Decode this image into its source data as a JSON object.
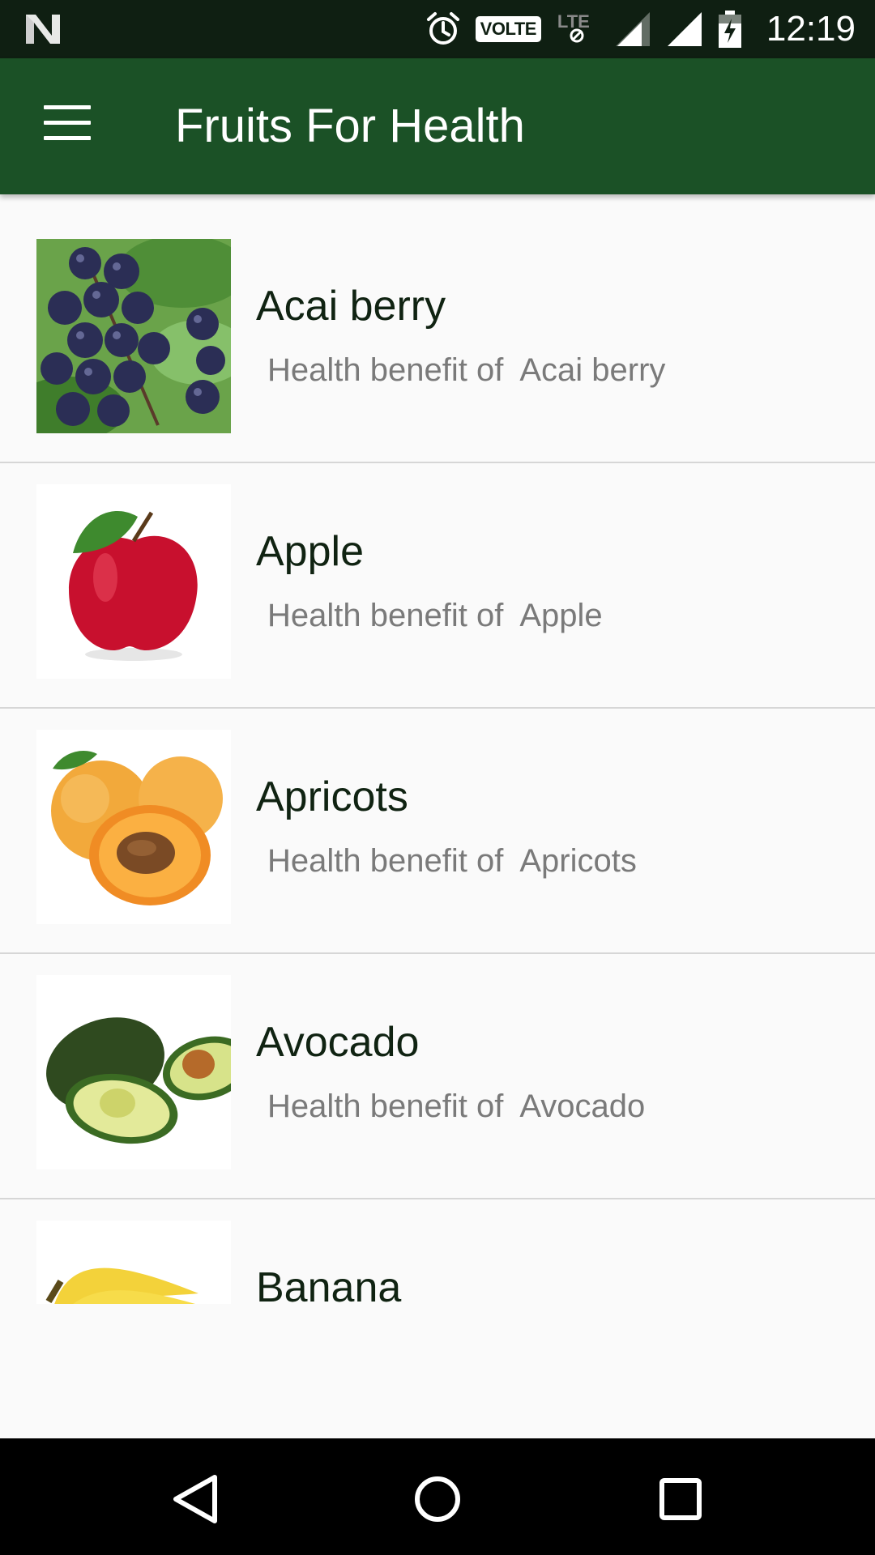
{
  "status_bar": {
    "time": "12:19",
    "volte_label": "VOLTE",
    "lte_label": "LTE",
    "icons": [
      "notification-n-icon",
      "alarm-icon",
      "volte-badge",
      "lte-no-data-icon",
      "signal-icon",
      "signal-icon",
      "battery-charging-icon"
    ]
  },
  "app_bar": {
    "title": "Fruits For Health",
    "menu_icon": "hamburger-menu-icon",
    "color": "#1b5126"
  },
  "list": {
    "items": [
      {
        "title": "Acai berry",
        "subtitle": "Health benefit of  Acai berry",
        "image": "acai-berry-image"
      },
      {
        "title": "Apple",
        "subtitle": "Health benefit of  Apple",
        "image": "apple-image"
      },
      {
        "title": "Apricots",
        "subtitle": "Health benefit of  Apricots",
        "image": "apricots-image"
      },
      {
        "title": "Avocado",
        "subtitle": "Health benefit of  Avocado",
        "image": "avocado-image"
      },
      {
        "title": "Banana",
        "subtitle": "",
        "image": "banana-image"
      }
    ]
  },
  "nav_bar": {
    "buttons": [
      "back-icon",
      "home-icon",
      "recents-icon"
    ]
  }
}
